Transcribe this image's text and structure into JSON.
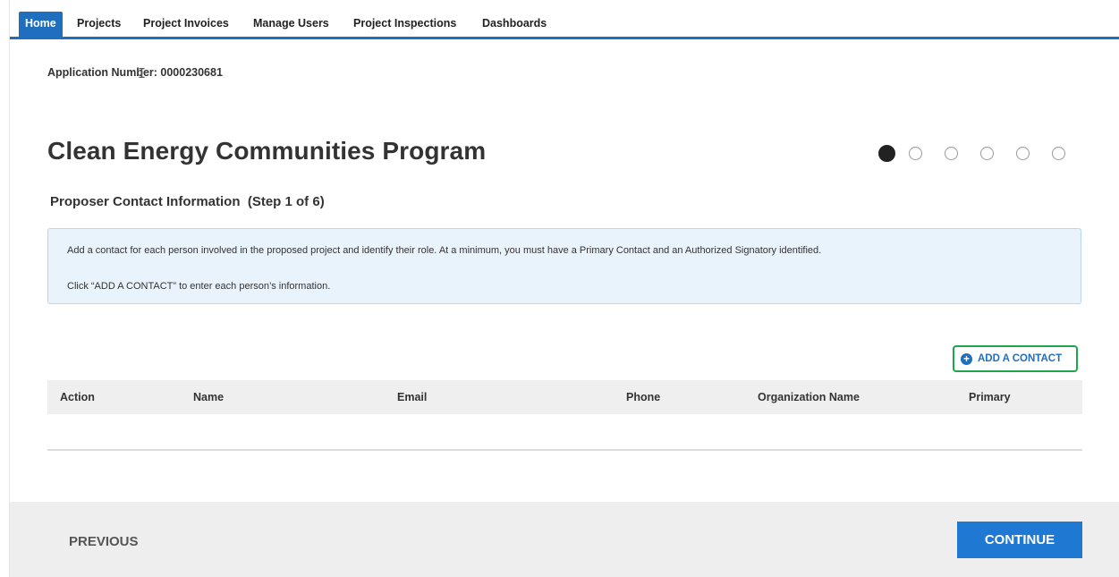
{
  "nav": {
    "items": [
      {
        "label": "Home",
        "active": true
      },
      {
        "label": "Projects"
      },
      {
        "label": "Project Invoices"
      },
      {
        "label": "Manage Users"
      },
      {
        "label": "Project Inspections"
      },
      {
        "label": "Dashboards"
      }
    ]
  },
  "application": {
    "number_label": "Application Number: 0000230681"
  },
  "page": {
    "title": "Clean Energy Communities Program",
    "subtitle": "Proposer Contact Information  (Step 1 of 6)",
    "current_step": 1,
    "total_steps": 6
  },
  "info": {
    "line1": "Add a contact for each person involved in the proposed project and identify their role. At a minimum, you must have a Primary Contact and an Authorized Signatory identified.",
    "line2": "Click “ADD A CONTACT” to enter each person’s information."
  },
  "contacts": {
    "add_label": "ADD A CONTACT",
    "columns": [
      "Action",
      "Name",
      "Email",
      "Phone",
      "Organization Name",
      "Primary"
    ],
    "rows": []
  },
  "footer": {
    "previous_label": "PREVIOUS",
    "continue_label": "CONTINUE"
  },
  "colors": {
    "accent": "#1f6fbe",
    "continue_bg": "#1f78d1",
    "highlight_border": "#1fa64a",
    "info_bg": "#e9f3fb"
  }
}
